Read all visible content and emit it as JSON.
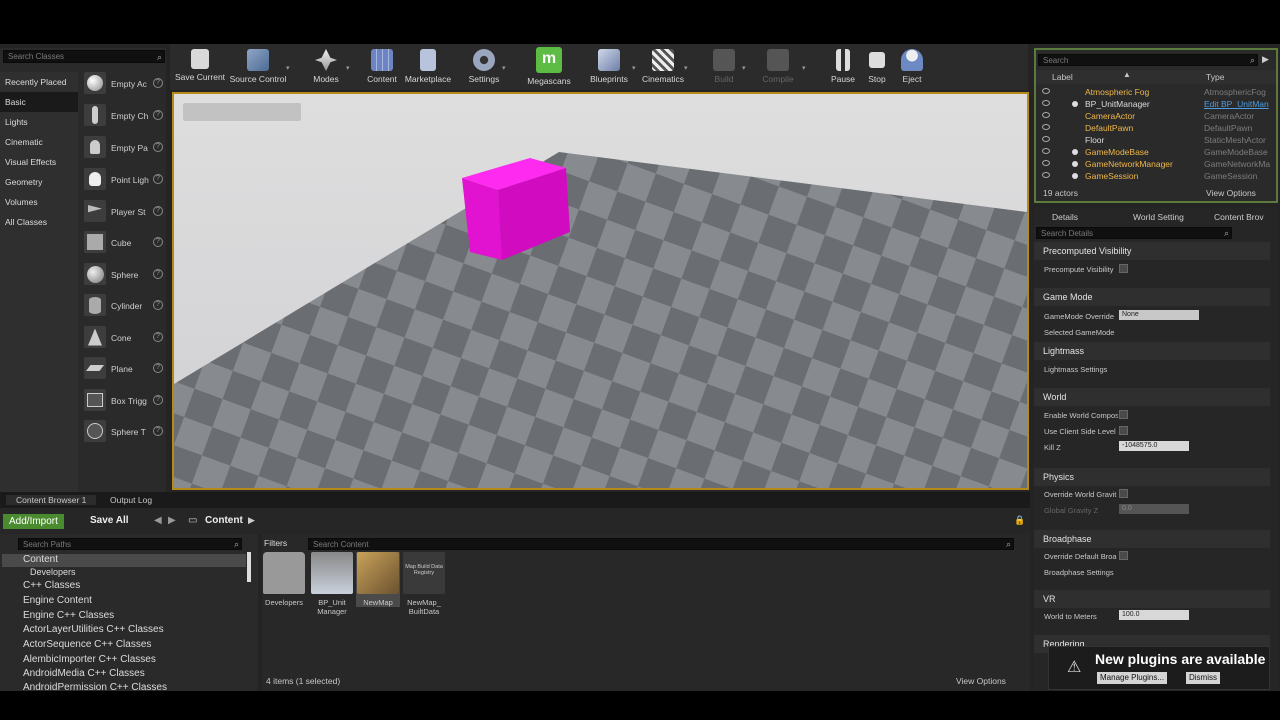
{
  "place": {
    "search_placeholder": "Search Classes",
    "categories": [
      "Recently Placed",
      "Basic",
      "Lights",
      "Cinematic",
      "Visual Effects",
      "Geometry",
      "Volumes",
      "All Classes"
    ],
    "items": [
      "Empty Ac",
      "Empty Ch",
      "Empty Pa",
      "Point Ligh",
      "Player St",
      "Cube",
      "Sphere",
      "Cylinder",
      "Cone",
      "Plane",
      "Box Trigg",
      "Sphere T"
    ],
    "help": "?"
  },
  "toolbar": {
    "buttons": [
      "Save Current",
      "Source Control",
      "Modes",
      "Content",
      "Marketplace",
      "Settings",
      "Megascans",
      "Blueprints",
      "Cinematics",
      "Build",
      "Compile",
      "Pause",
      "Stop",
      "Eject"
    ],
    "dropdown": "▾"
  },
  "outliner": {
    "search_placeholder": "Search",
    "col_label": "Label",
    "col_type": "Type",
    "rows": [
      {
        "name": "Atmospheric Fog",
        "type": "AtmosphericFog"
      },
      {
        "name": "BP_UnitManager",
        "type": "Edit BP_UnitMan"
      },
      {
        "name": "CameraActor",
        "type": "CameraActor"
      },
      {
        "name": "DefaultPawn",
        "type": "DefaultPawn"
      },
      {
        "name": "Floor",
        "type": "StaticMeshActor"
      },
      {
        "name": "GameModeBase",
        "type": "GameModeBase"
      },
      {
        "name": "GameNetworkManager",
        "type": "GameNetworkMa"
      },
      {
        "name": "GameSession",
        "type": "GameSession"
      }
    ],
    "count": "19 actors",
    "view_options": "View Options"
  },
  "details": {
    "tabs": [
      "Details",
      "World Setting",
      "Content Brov"
    ],
    "search_placeholder": "Search Details",
    "sections": {
      "precomputed": "Precomputed Visibility",
      "gamemode": "Game Mode",
      "lightmass": "Lightmass",
      "world": "World",
      "physics": "Physics",
      "broadphase": "Broadphase",
      "vr": "VR",
      "rendering": "Rendering"
    },
    "props": {
      "precompute": "Precompute Visibility",
      "gm_override": "GameMode Override",
      "gm_value": "None",
      "selected_gm": "Selected GameMode",
      "lightmass_settings": "Lightmass Settings",
      "enable_world": "Enable World Compos",
      "client_side": "Use Client Side Level",
      "killz": "Kill Z",
      "killz_value": "-1048575.0",
      "override_grav": "Override World Gravit",
      "global_grav": "Global Gravity Z",
      "global_grav_value": "0.0",
      "override_broad": "Override Default Broa",
      "broad_settings": "Broadphase Settings",
      "world_to_meters": "World to Meters",
      "wtm_value": "100.0"
    }
  },
  "content": {
    "tabs": [
      "Content Browser 1",
      "Output Log"
    ],
    "add_import": "Add/Import",
    "save_all": "Save All",
    "path_root": "Content",
    "paths_placeholder": "Search Paths",
    "filters": "Filters",
    "content_placeholder": "Search Content",
    "tree": [
      "Content",
      "Developers",
      "C++ Classes",
      "Engine Content",
      "Engine C++ Classes",
      "ActorLayerUtilities C++ Classes",
      "ActorSequence C++ Classes",
      "AlembicImporter C++ Classes",
      "AndroidMedia C++ Classes",
      "AndroidPermission C++ Classes"
    ],
    "assets": [
      {
        "label": "Developers"
      },
      {
        "label": "BP_Unit Manager"
      },
      {
        "label": "NewMap"
      },
      {
        "label": "NewMap_ BuiltData",
        "thumb": "Map Build Data Registry"
      }
    ],
    "status": "4 items (1 selected)",
    "view_options": "View Options"
  },
  "notification": {
    "title": "New plugins are available",
    "manage": "Manage Plugins...",
    "dismiss": "Dismiss"
  },
  "colors": {
    "accent": "#b48a18",
    "actor_name": "#f0b84a",
    "cube": "#e112d0",
    "add_import": "#4b8b2f"
  }
}
